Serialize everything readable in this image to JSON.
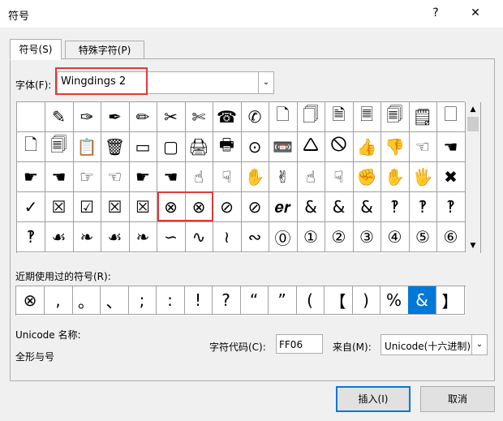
{
  "window": {
    "title": "符号",
    "help": "?",
    "close": "✕"
  },
  "tabs": [
    {
      "label": "符号(S)"
    },
    {
      "label": "特殊字符(P)"
    }
  ],
  "font": {
    "label": "字体(F):",
    "value": "Wingdings 2",
    "dropdown": "⌄"
  },
  "grid": {
    "rows": [
      [
        "",
        "✎",
        "✑",
        "✒",
        "✏",
        "✂",
        "✄",
        "☎",
        "✆",
        "🗋",
        "🗍",
        "🗎",
        "🗏",
        "🗐",
        "🗒",
        "🗌"
      ],
      [
        "🗋",
        "🗐",
        "📋",
        "🗑",
        "▭",
        "▢",
        "🖨",
        "🖶",
        "⊙",
        "📼",
        "🛆",
        "🛇",
        "👍",
        "👎",
        "☜",
        "☚"
      ],
      [
        "☛",
        "☚",
        "☞",
        "☜",
        "☛",
        "☚",
        "☝",
        "☟",
        "✋",
        "✌",
        "☝",
        "☟",
        "✊",
        "✋",
        "🖐",
        "✖"
      ],
      [
        "✓",
        "☒",
        "☑",
        "☒",
        "☒",
        "⊗",
        "⊗",
        "⊘",
        "⊘",
        "𝒆𝒓",
        "&",
        "&",
        "&",
        "‽",
        "‽",
        "‽"
      ],
      [
        "‽",
        "☙",
        "❧",
        "☙",
        "❧",
        "∽",
        "∿",
        "≀",
        "∾",
        "⓪",
        "①",
        "②",
        "③",
        "④",
        "⑤",
        "⑥"
      ]
    ]
  },
  "recent": {
    "label": "近期使用过的符号(R):",
    "items": [
      "⊗",
      ",",
      "。",
      "、",
      ";",
      ":",
      "!",
      "?",
      "“",
      "”",
      "(",
      "【",
      ")",
      "%",
      "&",
      "】"
    ],
    "selected_index": 14
  },
  "unicode": {
    "label": "Unicode 名称:",
    "name": "全形与号"
  },
  "code": {
    "label": "字符代码(C):",
    "value": "FF06"
  },
  "from": {
    "label": "来自(M):",
    "value": "Unicode(十六进制)"
  },
  "buttons": {
    "insert": "插入(I)",
    "cancel": "取消"
  }
}
